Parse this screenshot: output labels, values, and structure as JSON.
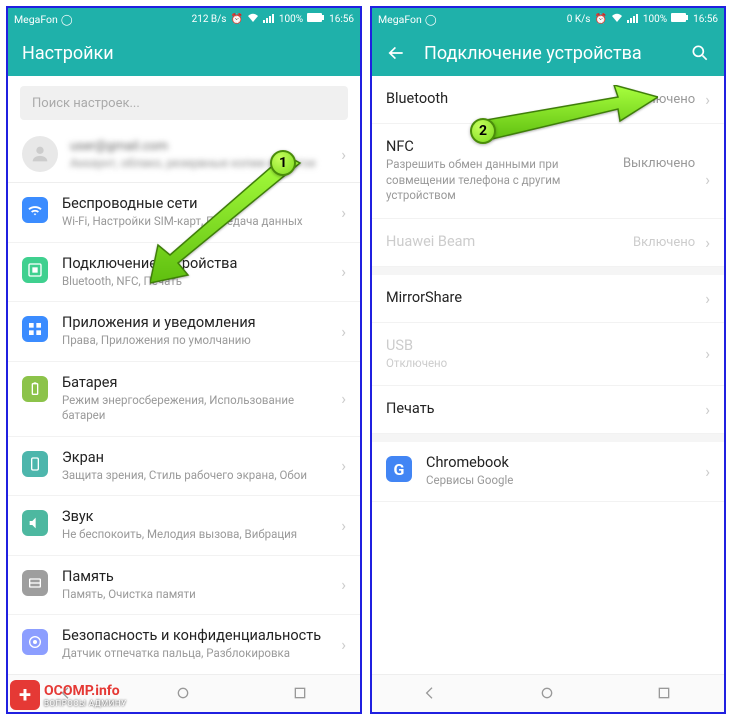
{
  "status": {
    "carrier": "MegaFon",
    "speed_left": "212 B/s",
    "speed_right": "0 K/s",
    "battery": "100%",
    "time": "16:56"
  },
  "left": {
    "title": "Настройки",
    "search_placeholder": "Поиск настроек...",
    "account": {
      "line1": "user@gmail.com",
      "line2": "Аккаунт, облако, резервные копии и другое"
    },
    "items": [
      {
        "title": "Беспроводные сети",
        "sub": "Wi-Fi, Настройки SIM-карт, Передача данных"
      },
      {
        "title": "Подключение устройства",
        "sub": "Bluetooth, NFC, Печать"
      },
      {
        "title": "Приложения и уведомления",
        "sub": "Права, Приложения по умолчанию"
      },
      {
        "title": "Батарея",
        "sub": "Режим энергосбережения, Использование батареи"
      },
      {
        "title": "Экран",
        "sub": "Защита зрения, Стиль рабочего экрана, Обои"
      },
      {
        "title": "Звук",
        "sub": "Не беспокоить, Мелодия вызова, Вибрация"
      },
      {
        "title": "Память",
        "sub": "Память, Очистка памяти"
      },
      {
        "title": "Безопасность и конфиденциальность",
        "sub": "Датчик отпечатка пальца, Разблокировка"
      }
    ]
  },
  "right": {
    "title": "Подключение устройства",
    "rows": [
      {
        "title": "Bluetooth",
        "sub": "",
        "value": "Выключено",
        "disabled": false
      },
      {
        "title": "NFC",
        "sub": "Разрешить обмен данными при совмещении телефона с другим устройством",
        "value": "Выключено",
        "disabled": false
      },
      {
        "title": "Huawei Beam",
        "sub": "",
        "value": "Включено",
        "disabled": true
      },
      {
        "title": "MirrorShare",
        "sub": "",
        "value": "",
        "disabled": false
      },
      {
        "title": "USB",
        "sub": "Отключено",
        "value": "",
        "disabled": true
      },
      {
        "title": "Печать",
        "sub": "",
        "value": "",
        "disabled": false
      }
    ],
    "chromebook": {
      "title": "Chromebook",
      "sub": "Сервисы Google"
    }
  },
  "markers": {
    "one": "1",
    "two": "2"
  },
  "watermark": {
    "brand": "OCOMP",
    "domain": ".info",
    "slogan": "ВОПРОСЫ АДМИНУ"
  }
}
